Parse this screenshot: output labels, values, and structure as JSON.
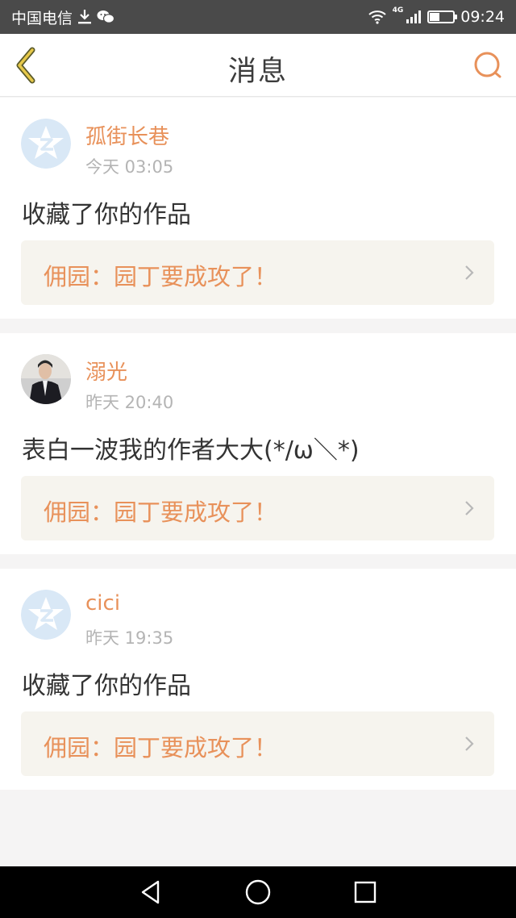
{
  "status_bar": {
    "carrier": "中国电信",
    "network": "4G",
    "time": "09:24",
    "battery_level": 0.4,
    "icons": [
      "download-icon",
      "wechat-icon",
      "wifi-icon",
      "signal-icon",
      "battery-icon"
    ]
  },
  "header": {
    "title": "消息",
    "back_icon": "chevron-left-icon",
    "search_icon": "search-icon"
  },
  "colors": {
    "accent": "#e8915a",
    "header_bg": "#ffffff",
    "status_bg": "#4a4a4a",
    "page_bg": "#f5f4f4",
    "link_bg": "#f6f4ee"
  },
  "messages": [
    {
      "user": "孤街长巷",
      "time": "今天 03:05",
      "avatar": "default-qzone-avatar",
      "text": "收藏了你的作品",
      "work": "佣园：园丁要成攻了！"
    },
    {
      "user": "溺光",
      "time": "昨天 20:40",
      "avatar": "photo-avatar",
      "text": "表白一波我的作者大大(*/ω＼*)",
      "work": "佣园：园丁要成攻了！"
    },
    {
      "user": "cici",
      "time": "昨天 19:35",
      "avatar": "default-qzone-avatar",
      "text": "收藏了你的作品",
      "work": "佣园：园丁要成攻了！"
    }
  ],
  "nav_bar": {
    "buttons": [
      "back-triangle-icon",
      "home-circle-icon",
      "recents-square-icon"
    ]
  }
}
